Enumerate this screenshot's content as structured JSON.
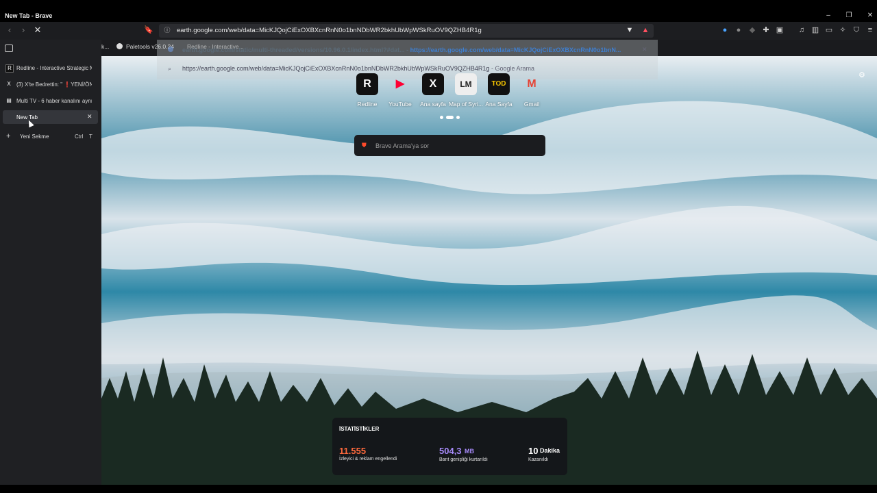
{
  "window": {
    "title": "New Tab - Brave",
    "minimize_glyph": "–",
    "restore_glyph": "❐",
    "close_glyph": "✕"
  },
  "toolbar": {
    "url": "earth.google.com/web/data=MicKJQojCiExOXBXcnRnN0o1bnNDbWR2bkhUbWpWSkRuOV9QZHB4R1g"
  },
  "bookmarks": [
    {
      "label": "k..."
    },
    {
      "label": "Paletools v26.0.24"
    },
    {
      "label": "Redline - Interactive..."
    }
  ],
  "omnibox": {
    "suggestion_1_prefix": "earth.google.com/static/multi-threaded/versions/10.96.0.1/index.html?#dat...",
    "suggestion_1_sep": "-",
    "suggestion_1_url": "https://earth.google.com/web/data=MicKJQojCiExOXBXcnRnN0o1bnN...",
    "suggestion_2": "https://earth.google.com/web/data=MicKJQojCiExOXBXcnRnN0o1bnNDbWR2bkhUbWpWSkRuOV9QZHB4R1g",
    "suggestion_2_suffix": "- Google Arama"
  },
  "sidebar": {
    "tabs": [
      {
        "label": "Redline - Interactive Strategic M",
        "icon": "R"
      },
      {
        "label": "(3) X'te Bedrettin: \" ❗YENİ/ÖN",
        "icon": "X"
      },
      {
        "label": "Multi TV - 6 haber kanalını aynı",
        "icon": "▤"
      },
      {
        "label": "New Tab",
        "icon": ""
      }
    ],
    "new_tab_label": "Yeni Sekme",
    "new_tab_shortcut_1": "Ctrl",
    "new_tab_shortcut_2": "T"
  },
  "tiles": [
    {
      "label": "Redline",
      "glyph": "R"
    },
    {
      "label": "YouTube",
      "glyph": "▶"
    },
    {
      "label": "Ana sayfa",
      "glyph": "X"
    },
    {
      "label": "Map of Syri...",
      "glyph": "LM"
    },
    {
      "label": "Ana Sayfa",
      "glyph": "TOD"
    },
    {
      "label": "Gmail",
      "glyph": "M"
    }
  ],
  "search": {
    "placeholder": "Brave Arama'ya sor"
  },
  "stats": {
    "title": "İSTATİSTİKLER",
    "blocked_value": "11.555",
    "blocked_label": "İzleyici & reklam engellendi",
    "bandwidth_value": "504,3",
    "bandwidth_unit": "MB",
    "bandwidth_label": "Bant genişliği kurtarıldı",
    "time_value": "10",
    "time_unit": "Dakika",
    "time_label": "Kazanıldı"
  },
  "colors": {
    "accent_orange": "#ff6a3d",
    "accent_purple": "#a78bfa"
  }
}
